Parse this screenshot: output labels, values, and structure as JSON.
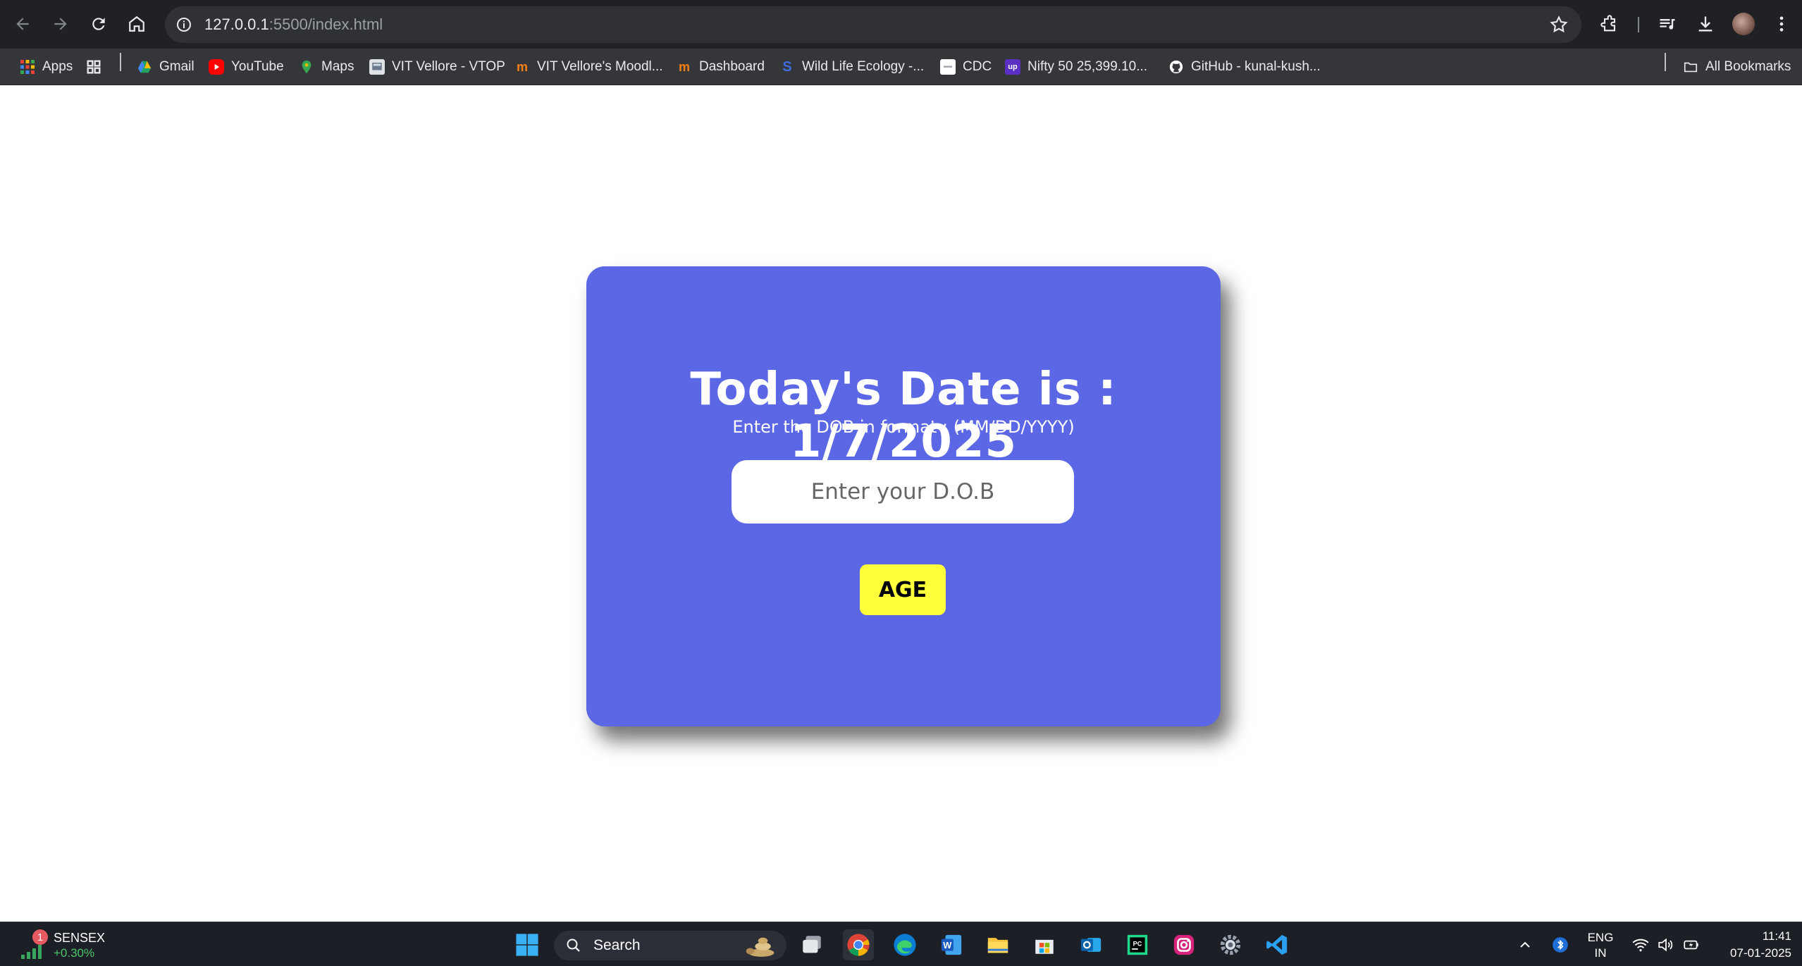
{
  "browser": {
    "url_host": "127.0.0.1",
    "url_path": ":5500/index.html",
    "bookmarks": [
      {
        "label": "Apps",
        "icon": "apps-grid-icon",
        "color": "#ea4335"
      },
      {
        "label": "Gmail",
        "icon": "google-drive-icon",
        "color": "#1ea362"
      },
      {
        "label": "YouTube",
        "icon": "youtube-icon",
        "color": "#ff0000"
      },
      {
        "label": "Maps",
        "icon": "maps-pin-icon",
        "color": "#34a853"
      },
      {
        "label": "VIT Vellore - VTOP",
        "icon": "vtop-icon",
        "color": "#9aa0a6"
      },
      {
        "label": "VIT Vellore's Moodl...",
        "icon": "moodle-icon",
        "color": "#f98012"
      },
      {
        "label": "Dashboard",
        "icon": "moodle-icon",
        "color": "#f98012"
      },
      {
        "label": "Wild Life Ecology -...",
        "icon": "swayam-icon",
        "color": "#3d6de0"
      },
      {
        "label": "CDC",
        "icon": "cdc-icon",
        "color": "#ffffff"
      },
      {
        "label": "Nifty 50 25,399.10...",
        "icon": "upstox-icon",
        "color": "#5a2fc2"
      },
      {
        "label": "GitHub - kunal-kush...",
        "icon": "github-icon",
        "color": "#ffffff"
      }
    ],
    "all_bookmarks": "All Bookmarks"
  },
  "page": {
    "heading": "Today's Date is : 1/7/2025",
    "hint": "Enter the DOB in format : (MM/DD/YYYY)",
    "dob_placeholder": "Enter your D.O.B",
    "age_button": "AGE",
    "card_color": "#5b67e5",
    "button_color": "#ffff3c"
  },
  "taskbar": {
    "stock_badge": "1",
    "stock_name": "SENSEX",
    "stock_change": "+0.30%",
    "search_label": "Search",
    "language_top": "ENG",
    "language_bottom": "IN",
    "time": "11:41",
    "date": "07-01-2025"
  }
}
